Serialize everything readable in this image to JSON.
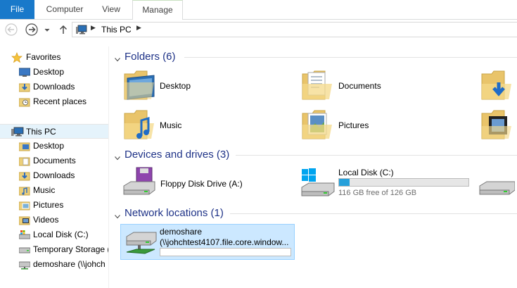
{
  "ribbon": {
    "tabs": [
      "File",
      "Computer",
      "View",
      "Manage"
    ],
    "colors": {
      "file_tab": "#1979ca"
    }
  },
  "address": {
    "location": "This PC"
  },
  "navpane": {
    "favorites_label": "Favorites",
    "favorites": [
      "Desktop",
      "Downloads",
      "Recent places"
    ],
    "thispc_label": "This PC",
    "thispc_items": [
      "Desktop",
      "Documents",
      "Downloads",
      "Music",
      "Pictures",
      "Videos",
      "Local Disk (C:)",
      "Temporary Storage (",
      "demoshare (\\\\johch"
    ]
  },
  "groups": {
    "folders": "Folders (6)",
    "devices": "Devices and drives (3)",
    "network": "Network locations (1)"
  },
  "folders": [
    "Desktop",
    "Documents",
    "Music",
    "Pictures"
  ],
  "devices": {
    "floppy": "Floppy Disk Drive (A:)",
    "local_disk": "Local Disk (C:)",
    "local_disk_free": "116 GB free of 126 GB",
    "local_disk_used_fraction": 0.08
  },
  "network": {
    "name": "demoshare",
    "path": "(\\\\johchtest4107.file.core.window..."
  },
  "colors": {
    "group_heading": "#1e3287",
    "selection": "#cce8ff",
    "drive_fill": "#26a0da"
  }
}
